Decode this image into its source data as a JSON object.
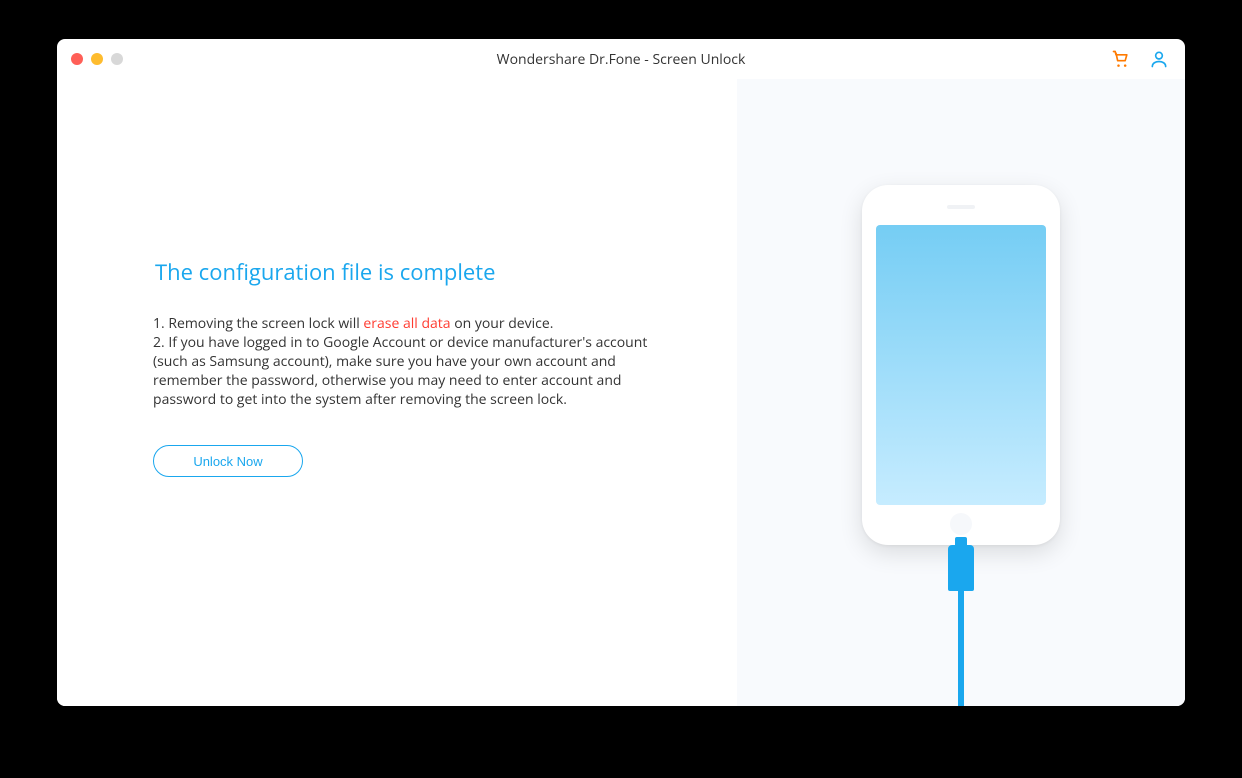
{
  "header": {
    "title": "Wondershare Dr.Fone - Screen Unlock"
  },
  "main": {
    "heading": "The configuration file is complete",
    "note1_prefix": "1. Removing the screen lock will ",
    "note1_emph": "erase all data",
    "note1_suffix": " on your device.",
    "note2": "2. If you have logged in to Google Account or device manufacturer's account (such as Samsung account), make sure you have your own account and remember the password, otherwise you may need to enter account and password to get into the system after removing the screen lock.",
    "unlock_label": "Unlock Now"
  },
  "colors": {
    "accent": "#1aa7ee",
    "cart": "#ff7a00",
    "danger": "#ff3b30"
  }
}
